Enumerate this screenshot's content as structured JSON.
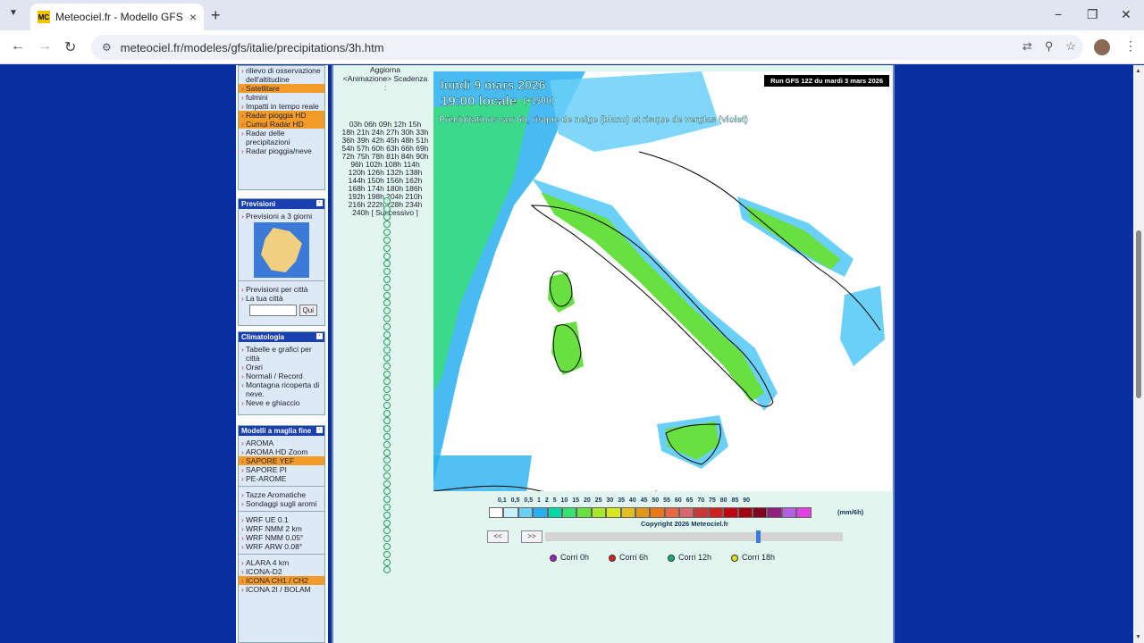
{
  "browser": {
    "tab_title": "Meteociel.fr - Modello GFS per",
    "favicon_text": "MC",
    "url": "meteociel.fr/modeles/gfs/italie/precipitations/3h.htm",
    "minimize": "−",
    "restore": "❐",
    "close": "✕"
  },
  "sidebar": {
    "box1": {
      "items": [
        {
          "label": "rilievo di osservazione dell'altitudine",
          "hl": false
        },
        {
          "label": "Satellitare",
          "hl": true
        },
        {
          "label": "fulmini",
          "hl": false
        },
        {
          "label": "Impatti in tempo reale",
          "hl": false
        },
        {
          "label": "Radar pioggia HD",
          "hl": true
        },
        {
          "label": "Cumul Radar HD",
          "hl": true
        },
        {
          "label": "Radar delle precipitazioni",
          "hl": false
        },
        {
          "label": "Radar pioggia/neve",
          "hl": false
        }
      ]
    },
    "previsioni": {
      "header": "Previsioni",
      "item1": "Previsioni a 3 giorni",
      "item2": "Previsioni per città",
      "item3": "La tua città",
      "button": "Qui"
    },
    "climatologia": {
      "header": "Climatologia",
      "items": [
        "Tabelle e grafici per città",
        "Orari",
        "Normali / Record",
        "Montagna ricoperta di neve.",
        "Neve e ghiaccio"
      ]
    },
    "modelli": {
      "header": "Modelli a maglia fine",
      "items1": [
        {
          "label": "AROMA",
          "hl": false
        },
        {
          "label": "AROMA HD Zoom",
          "hl": false
        },
        {
          "label": "SAPORE YEF",
          "hl": true
        },
        {
          "label": "SAPORE PI",
          "hl": false
        },
        {
          "label": "PE-AROME",
          "hl": false
        }
      ],
      "items2": [
        {
          "label": "Tazze Aromatiche",
          "hl": false
        },
        {
          "label": "Sondaggi sugli aromi",
          "hl": false
        }
      ],
      "items3": [
        {
          "label": "WRF UE 0.1",
          "hl": false
        },
        {
          "label": "WRF NMM 2 km",
          "hl": false
        },
        {
          "label": "WRF NMM 0.05°",
          "hl": false
        },
        {
          "label": "WRF ARW 0.08°",
          "hl": false
        }
      ],
      "items4": [
        {
          "label": "ALARA 4 km",
          "hl": false
        },
        {
          "label": "ICONA-D2",
          "hl": false
        },
        {
          "label": "ICONA CH1 / CH2",
          "hl": true
        },
        {
          "label": "ICONA 2I / BOLAM",
          "hl": false
        }
      ]
    }
  },
  "main": {
    "aggiorna": "Aggiorna",
    "animazione": "<Animazione>",
    "scadenza": "Scadenza",
    "colon": ":",
    "hours": [
      "03h 06h 09h 12h 15h",
      "18h 21h 24h 27h 30h 33h",
      "36h 39h 42h 45h 48h 51h",
      "54h 57h 60h 63h 66h 69h",
      "72h 75h 78h 81h 84h 90h",
      "96h 102h 108h 114h",
      "120h 126h 132h 138h",
      "144h 150h 156h 162h",
      "168h 174h 180h 186h",
      "192h 198h 204h 210h",
      "216h 222h 228h 234h",
      "240h [ Successivo ]"
    ],
    "map": {
      "date_line": "lundi 9 mars 2026",
      "time_line": "19:00 locale",
      "step": "(+150h)",
      "desc": "Précipitations sur 6h, risque de neige (blanc) et risque de verglas (violet)",
      "run": "Run GFS 12Z du mardi 3 mars 2026",
      "legend_values": "0,1 0,5 0,5 1 2 5 10 15 20 25 30 35 40 45 50 55 60 65 70 75 80 85 90",
      "unit": "(mm/6h)",
      "copyright": "Copyright 2026 Meteociel.fr",
      "legend_colors": [
        "#ffffff",
        "#c8f0ff",
        "#6ad0f8",
        "#28b0f0",
        "#00d8a8",
        "#38e070",
        "#68e040",
        "#a8e828",
        "#d8e820",
        "#e0c020",
        "#e09818",
        "#e87818",
        "#e86848",
        "#d86870",
        "#c83838",
        "#d02020",
        "#c00010",
        "#a00010",
        "#800020",
        "#902080",
        "#b060e0",
        "#e040e0"
      ]
    },
    "prev": "<<",
    "next": ">>",
    "runs": [
      {
        "label": "Corri 0h",
        "color": "#a020c0"
      },
      {
        "label": "Corri 6h",
        "color": "#e02020"
      },
      {
        "label": "Corri 12h",
        "color": "#10b080"
      },
      {
        "label": "Corri 18h",
        "color": "#e0e020"
      }
    ]
  }
}
